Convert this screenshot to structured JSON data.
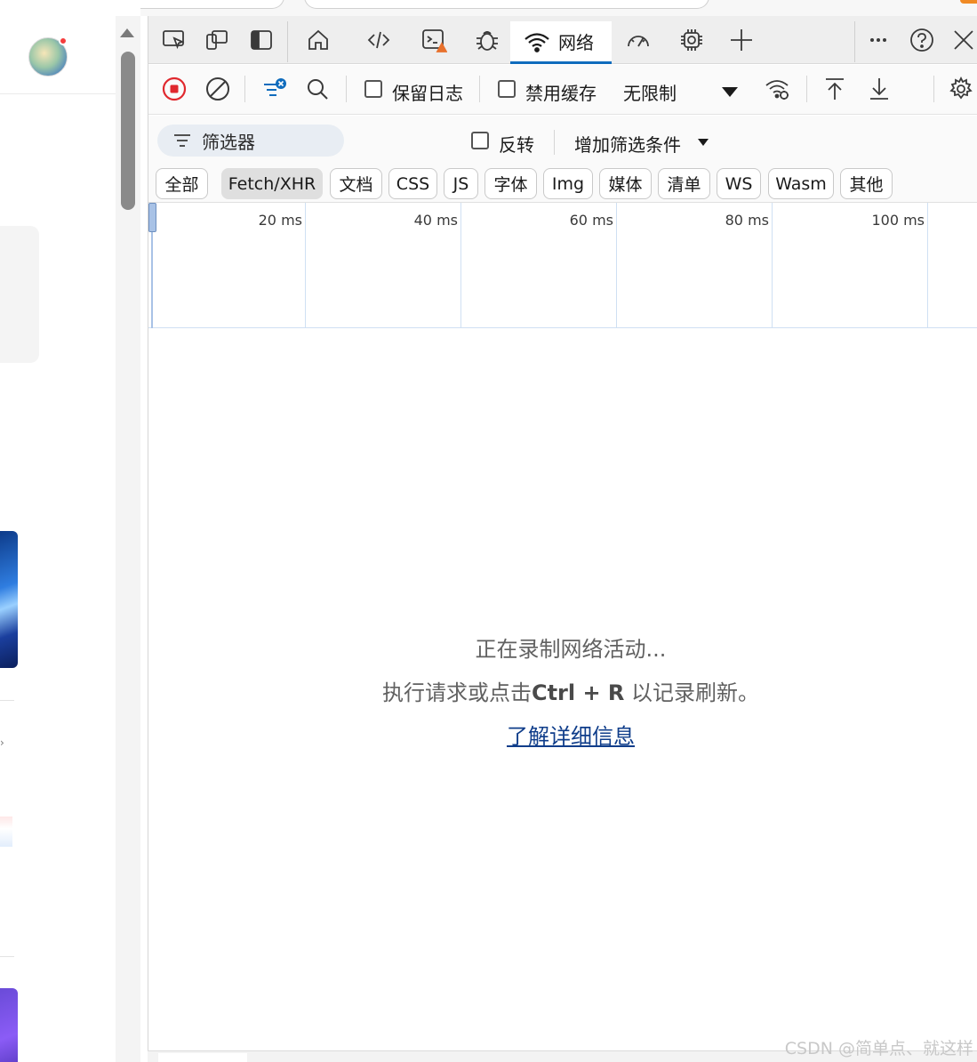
{
  "devtools": {
    "toolbar": {
      "active_tab_label": "网络",
      "tab_icons": [
        "inspect-icon",
        "device-emulation-icon",
        "dock-side-icon",
        "home-icon",
        "elements-icon",
        "console-icon",
        "sources-bug-icon",
        "network-icon",
        "performance-icon",
        "memory-chip-icon",
        "add-tool-icon",
        "more-icon",
        "help-icon",
        "close-icon"
      ]
    },
    "network_toolbar": {
      "preserve_log_label": "保留日志",
      "disable_cache_label": "禁用缓存",
      "throttle_value": "无限制"
    },
    "filter_row": {
      "filter_placeholder": "筛选器",
      "invert_label": "反转",
      "more_filters_label": "增加筛选条件"
    },
    "type_filters": [
      "全部",
      "Fetch/XHR",
      "文档",
      "CSS",
      "JS",
      "字体",
      "Img",
      "媒体",
      "清单",
      "WS",
      "Wasm",
      "其他"
    ],
    "selected_type_filter": "Fetch/XHR",
    "timeline": {
      "ticks": [
        "20 ms",
        "40 ms",
        "60 ms",
        "80 ms",
        "100 ms"
      ]
    },
    "empty_state": {
      "line1": "正在录制网络活动...",
      "line2_prefix": "执行请求或点击",
      "line2_shortcut": "Ctrl + R",
      "line2_suffix": " 以记录刷新。",
      "learn_more_link": "了解详细信息"
    },
    "accent_color": "#0f6cbd",
    "record_color": "#e0282e"
  },
  "watermark": "CSDN @简单点、就这样"
}
